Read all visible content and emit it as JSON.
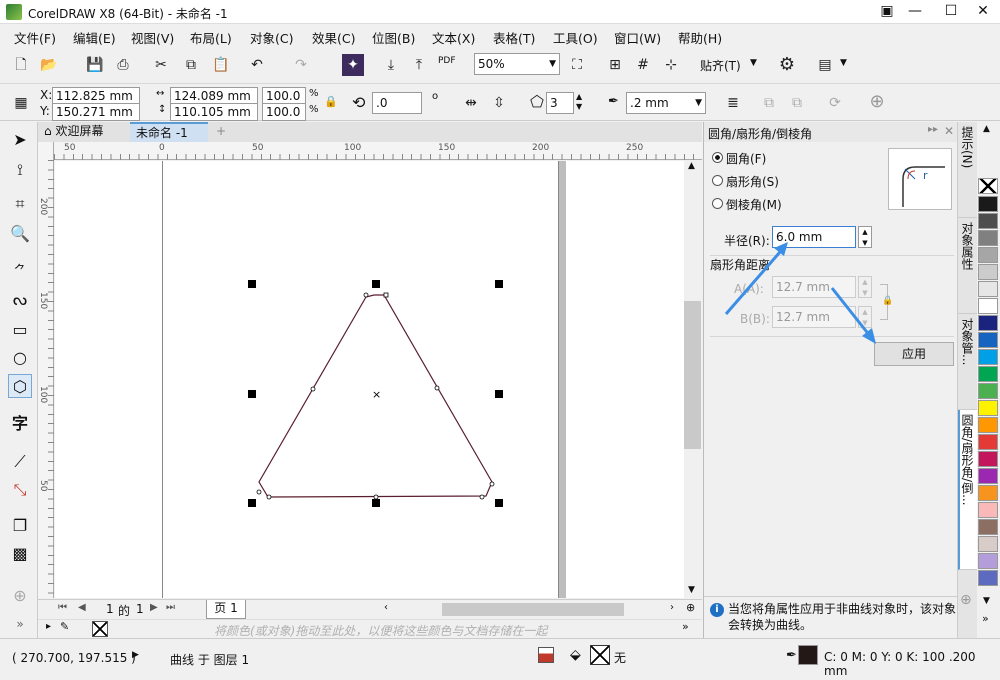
{
  "window": {
    "title": "CorelDRAW X8 (64-Bit) - 未命名 -1"
  },
  "menu": [
    "文件(F)",
    "编辑(E)",
    "视图(V)",
    "布局(L)",
    "对象(C)",
    "效果(C)",
    "位图(B)",
    "文本(X)",
    "表格(T)",
    "工具(O)",
    "窗口(W)",
    "帮助(H)"
  ],
  "toolbar": {
    "zoom": "50%",
    "snap": "贴齐(T)",
    "pdf": "PDF"
  },
  "propbar": {
    "x": "112.825 mm",
    "y": "150.271 mm",
    "w": "124.089 mm",
    "h": "110.105 mm",
    "sx": "100.0",
    "sy": "100.0",
    "pct": "%",
    "angle": ".0",
    "deg": "o",
    "sides": "3",
    "outline": ".2 mm"
  },
  "tabs": {
    "welcome": "欢迎屏幕",
    "doc": "未命名 -1",
    "add": "+"
  },
  "ruler": {
    "h": [
      "50",
      "0",
      "50",
      "100",
      "150",
      "200",
      "250"
    ],
    "v": [
      "200",
      "150",
      "100",
      "50"
    ]
  },
  "pagebar": {
    "current": "1",
    "of": "的",
    "total": "1",
    "page": "页 1"
  },
  "palettehint": "将颜色(或对象)拖动至此处，以便将这些颜色与文档存储在一起",
  "docker": {
    "title": "圆角/扇形角/倒棱角",
    "opt1": "圆角(F)",
    "opt2": "扇形角(S)",
    "opt3": "倒棱角(M)",
    "radius_label": "半径(R):",
    "radius_value": "6.0 mm",
    "section": "扇形角距离",
    "a_label": "A(A):",
    "a_value": "12.7 mm",
    "b_label": "B(B):",
    "b_value": "12.7 mm",
    "apply": "应用",
    "preview_letter": "r",
    "info": "当您将角属性应用于非曲线对象时，该对象会转换为曲线。"
  },
  "vtabs": [
    "提示(N)",
    "对象属性",
    "对象管...",
    "圆角/扇形角/倒..."
  ],
  "palette": [
    "#1a1a1a",
    "#4d4d4d",
    "#808080",
    "#a6a6a6",
    "#cccccc",
    "#e6e6e6",
    "#ffffff",
    "#1a237e",
    "#1565c0",
    "#00a0e9",
    "#00a651",
    "#4caf50",
    "#fff200",
    "#ff9800",
    "#e53935",
    "#c2185b",
    "#9c27b0",
    "#f7941d",
    "#f9b9b9",
    "#8d6e63",
    "#d7ccc8",
    "#b39ddb",
    "#5c6bc0"
  ],
  "status": {
    "coords": "( 270.700, 197.515 )",
    "object": "曲线 于 图层 1",
    "fill": "无",
    "outline": "C: 0 M: 0 Y: 0 K: 100  .200 mm"
  }
}
